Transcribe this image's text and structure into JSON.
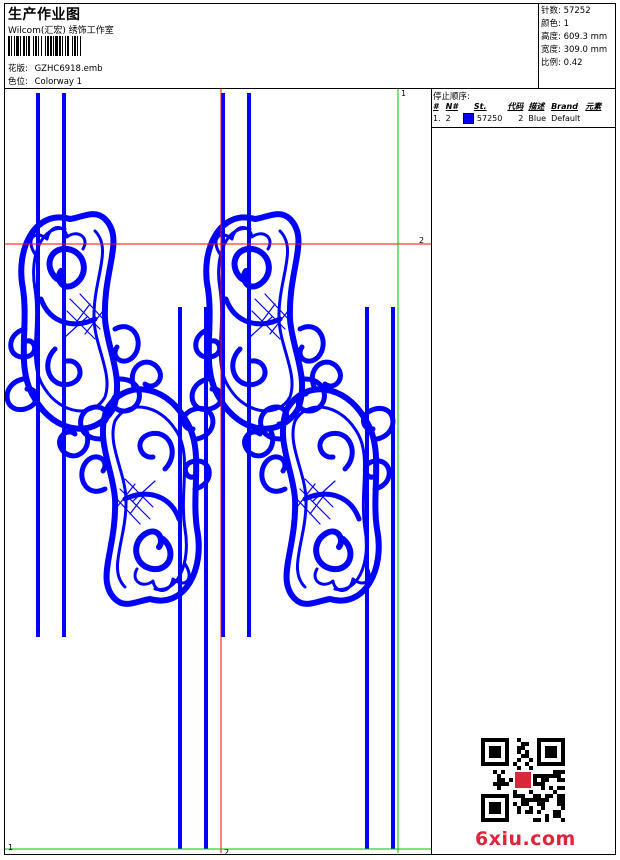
{
  "header": {
    "title": "生产作业图",
    "subtitle": "Wilcom(汇宏) 绣饰工作室",
    "design_label": "花版:",
    "design_value": "GZHC6918.emb",
    "colorway_label": "色位:",
    "colorway_value": "Colorway 1"
  },
  "stats": {
    "stitches_label": "针数:",
    "stitches_value": "57252",
    "colors_label": "颜色:",
    "colors_value": "1",
    "height_label": "高度:",
    "height_value": "609.3 mm",
    "width_label": "宽度:",
    "width_value": "309.0 mm",
    "scale_label": "比例:",
    "scale_value": "0.42"
  },
  "stop_sequence": {
    "heading": "停止顺序:",
    "columns": [
      "#",
      "N#",
      "St.",
      "代码",
      "描述",
      "Brand",
      "元素"
    ],
    "rows": [
      {
        "index": "1.",
        "needle": "2",
        "color": "#0000ff",
        "stitches": "57250",
        "code": "2",
        "desc": "Blue",
        "brand": "Default",
        "element": ""
      }
    ]
  },
  "canvas_marks": {
    "red_h_label": "2",
    "green_v_label": "1",
    "green_h_label": "1",
    "red_v_label": "2"
  },
  "watermark": "6xiu.com",
  "colors": {
    "stitch": "#0000ff",
    "guide_red": "#ff0000",
    "guide_green": "#00c000"
  }
}
